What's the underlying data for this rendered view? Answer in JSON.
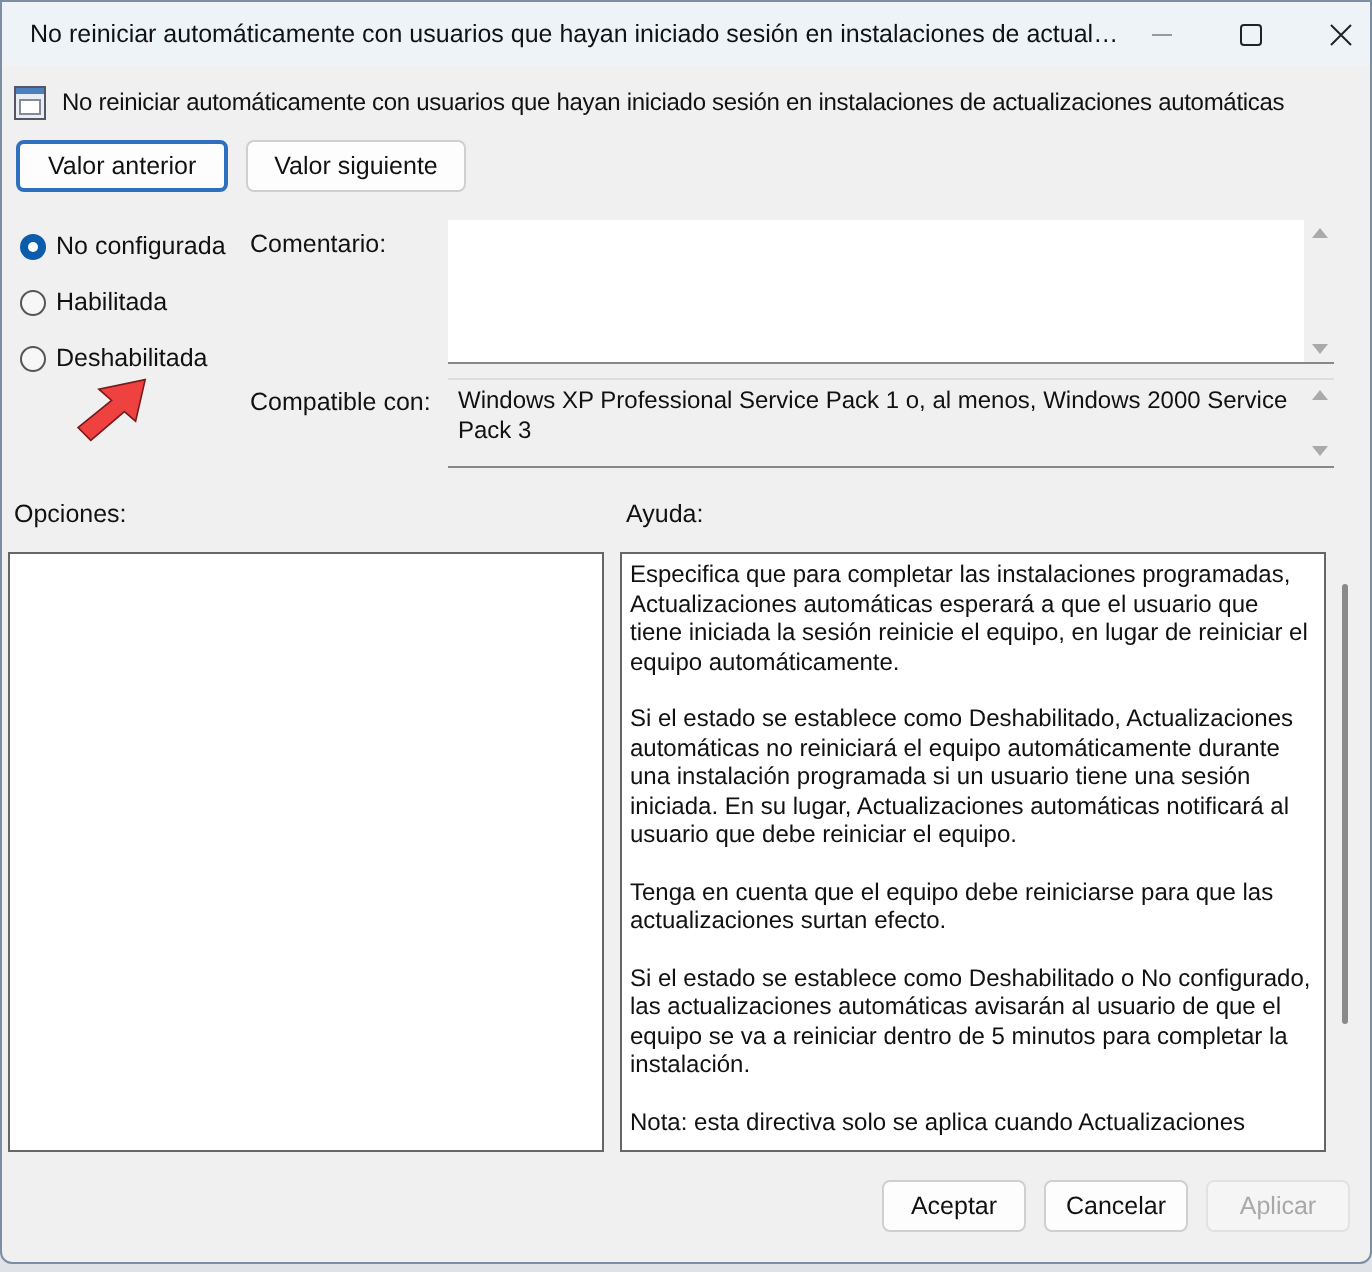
{
  "window": {
    "title": "No reiniciar automáticamente con usuarios que hayan iniciado sesión en instalaciones de actual…"
  },
  "header": {
    "title": "No reiniciar automáticamente con usuarios que hayan iniciado sesión en instalaciones de actualizaciones automáticas"
  },
  "nav_buttons": [
    {
      "label": "Valor anterior",
      "focused": true
    },
    {
      "label": "Valor siguiente",
      "focused": false
    }
  ],
  "state_options": [
    {
      "label": "No configurada",
      "selected": true
    },
    {
      "label": "Habilitada",
      "selected": false
    },
    {
      "label": "Deshabilitada",
      "selected": false
    }
  ],
  "comment": {
    "label": "Comentario:"
  },
  "compatible": {
    "label": "Compatible con:",
    "value": "Windows XP Professional Service Pack 1 o, al menos, Windows 2000 Service Pack 3"
  },
  "options": {
    "label": "Opciones:"
  },
  "help": {
    "label": "Ayuda:",
    "paragraphs": [
      "Especifica que para completar las instalaciones programadas, Actualizaciones automáticas esperará a que el usuario que tiene iniciada la sesión reinicie el equipo, en lugar de reiniciar el equipo automáticamente.",
      "Si el estado se establece como Deshabilitado, Actualizaciones automáticas no reiniciará el equipo automáticamente durante una instalación programada si un usuario tiene una sesión iniciada. En su lugar, Actualizaciones automáticas notificará al usuario que debe reiniciar el equipo.",
      "Tenga en cuenta que el equipo debe reiniciarse para que las actualizaciones surtan efecto.",
      "Si el estado se establece como Deshabilitado o No configurado, las actualizaciones automáticas avisarán al usuario de que el equipo se va a reiniciar dentro de 5 minutos para completar la instalación.",
      "Nota: esta directiva solo se aplica cuando Actualizaciones"
    ]
  },
  "buttons": [
    {
      "label": "Aceptar",
      "disabled": false
    },
    {
      "label": "Cancelar",
      "disabled": false
    },
    {
      "label": "Aplicar",
      "disabled": true
    }
  ]
}
